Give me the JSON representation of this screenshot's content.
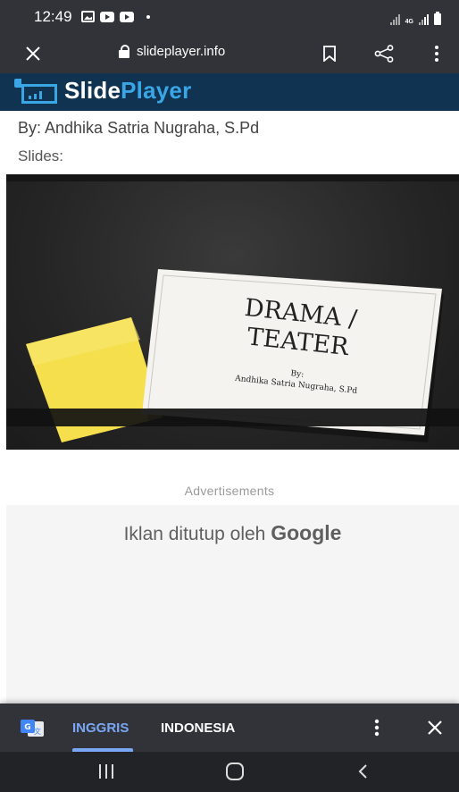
{
  "status_bar": {
    "time": "12:49",
    "network": "4G"
  },
  "browser": {
    "url": "slideplayer.info"
  },
  "site": {
    "logo_part1": "Slide",
    "logo_part2": "Player"
  },
  "page": {
    "by_line": "By: Andhika Satria Nugraha, S.Pd",
    "slides_label": "Slides:"
  },
  "slide": {
    "title": "DRAMA /\nTEATER",
    "by_label": "By:",
    "author": "Andhika Satria Nugraha, S.Pd"
  },
  "ads": {
    "label": "Advertisements",
    "closed_text": "Iklan ditutup oleh",
    "closed_brand": "Google"
  },
  "translate_bar": {
    "source_language": "INGGRIS",
    "target_language": "INDONESIA"
  },
  "colors": {
    "status_bar": "#313339",
    "site_header": "#0f3350",
    "logo_accent": "#3aa6e6",
    "active_tab": "#7aa7f5",
    "sticky_note": "#f7e35c"
  }
}
